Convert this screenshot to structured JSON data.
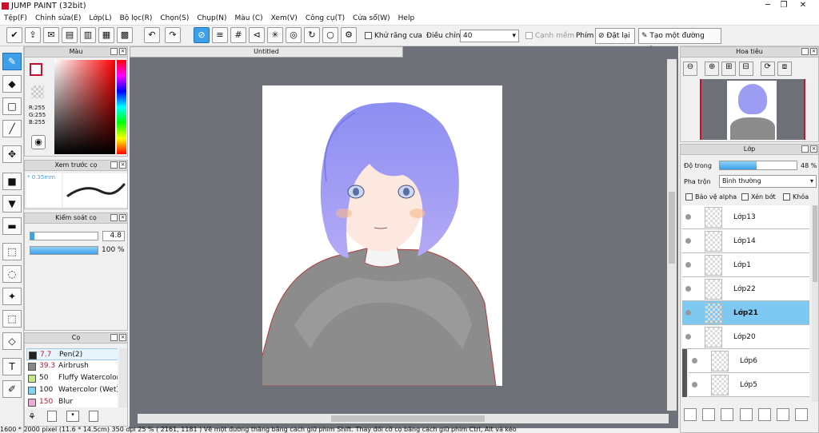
{
  "app": {
    "title": "JUMP PAINT (32bit)"
  },
  "menu": [
    "Tệp(F)",
    "Chỉnh sửa(E)",
    "Lớp(L)",
    "Bộ lọc(R)",
    "Chọn(S)",
    "Chụp(N)",
    "Màu (C)",
    "Xem(V)",
    "Công cụ(T)",
    "Cửa sổ(W)",
    "Help"
  ],
  "toolbar": {
    "antialias_label": "Khử răng cưa",
    "adjust_label": "Điều chỉnh",
    "adjust_value": "40",
    "canh_mem_label": "Cạnh mềm",
    "phim_label": "Phím",
    "reset_label": "Đặt lại",
    "straight_line_label": "Tạo một đường thẳng"
  },
  "canvas": {
    "tab_title": "Untitled"
  },
  "color_panel": {
    "title": "Màu",
    "r": "R:255",
    "g": "G:255",
    "b": "B:255"
  },
  "brush_preview": {
    "title": "Xem trước cọ",
    "size": "0.35mm"
  },
  "brush_control": {
    "title": "Kiểm soát cọ",
    "size_value": "4.8",
    "opacity_value": "100 %"
  },
  "brush_list": {
    "title": "Cọ",
    "items": [
      {
        "size": "7.7",
        "name": "Pen(2)",
        "color": "#222222"
      },
      {
        "size": "39.3",
        "name": "Airbrush",
        "color": "#888888"
      },
      {
        "size": "50",
        "name": "Fluffy Watercolor",
        "color": "#c6e48b"
      },
      {
        "size": "100",
        "name": "Watercolor (Wet)",
        "color": "#7fd4f0"
      },
      {
        "size": "150",
        "name": "Blur",
        "color": "#f0a8d8"
      }
    ]
  },
  "navigator": {
    "title": "Hoa tiêu"
  },
  "layers": {
    "title": "Lớp",
    "opacity_label": "Độ trong",
    "opacity_value": "48 %",
    "opacity_fraction": 0.48,
    "blend_label": "Pha trộn",
    "blend_value": "Bình thường",
    "protect_alpha": "Bảo vệ alpha",
    "clip": "Xén bớt",
    "lock": "Khóa",
    "items": [
      {
        "name": "Lớp13"
      },
      {
        "name": "Lớp14"
      },
      {
        "name": "Lớp1"
      },
      {
        "name": "Lớp22"
      },
      {
        "name": "Lớp21",
        "selected": true
      },
      {
        "name": "Lớp20"
      },
      {
        "name": "Lớp6"
      },
      {
        "name": "Lớp5"
      }
    ]
  },
  "status": {
    "text": "1600 * 2000 pixel  (11.6 * 14.5cm)  350 dpi  25 %  ( 2161, 1181 )  Vẽ một đường thẳng bằng cách giữ phím Shift. Thay đổi cỡ cọ bằng cách giữ phím Ctrl, Alt và kéo"
  },
  "colors": {
    "accent": "#3ea0e8",
    "selected_layer": "#7ec9f2",
    "canvas_bg": "#6e7177",
    "hair": "#8b8cf0",
    "sweater": "#8c8c8c"
  }
}
